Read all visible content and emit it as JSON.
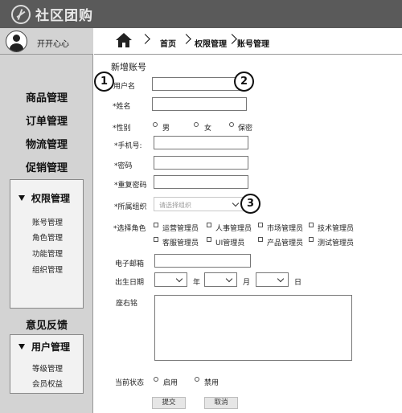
{
  "app": {
    "title": "社区团购",
    "logo_icon": "logo-icon"
  },
  "user": {
    "name": "开开心心",
    "avatar_icon": "user-avatar-icon"
  },
  "nav": {
    "main_items": [
      "商品管理",
      "订单管理",
      "物流管理",
      "促销管理"
    ],
    "groups": [
      {
        "label": "权限管理",
        "items": [
          "账号管理",
          "角色管理",
          "功能管理",
          "组织管理"
        ]
      },
      {
        "label": "意见反馈"
      },
      {
        "label": "用户管理",
        "items": [
          "等级管理",
          "会员权益"
        ]
      }
    ]
  },
  "breadcrumb": {
    "home_icon": "home-icon",
    "items": [
      "首页",
      "权限管理",
      "账号管理"
    ]
  },
  "form": {
    "title": "新增账号",
    "username": {
      "label": "用户名",
      "value": ""
    },
    "name": {
      "label": "*姓名",
      "value": ""
    },
    "gender": {
      "label": "*性别",
      "options": [
        "男",
        "女",
        "保密"
      ]
    },
    "phone": {
      "label": "*手机号:",
      "value": ""
    },
    "password": {
      "label": "*密码",
      "value": ""
    },
    "password_repeat": {
      "label": "*重复密码",
      "value": ""
    },
    "org": {
      "label": "*所属组织",
      "placeholder": "请选择组织"
    },
    "roles": {
      "label": "*选择角色",
      "options": [
        "运营管理员",
        "人事管理员",
        "市场管理员",
        "技术管理员",
        "客服管理员",
        "UI管理员",
        "产品管理员",
        "测试管理员"
      ]
    },
    "email": {
      "label": "电子邮箱",
      "value": ""
    },
    "birthday": {
      "label": "出生日期",
      "year_unit": "年",
      "month_unit": "月",
      "day_unit": "日"
    },
    "motto": {
      "label": "座右铭",
      "value": ""
    },
    "status": {
      "label": "当前状态",
      "options": [
        "启用",
        "禁用"
      ]
    },
    "submit_label": "提交",
    "cancel_label": "取消"
  },
  "annotations": [
    "1",
    "2",
    "3"
  ],
  "colors": {
    "topbar": "#5a5a5a",
    "sidebar": "#d3d3d3",
    "subpanel": "#f2f2f2"
  }
}
